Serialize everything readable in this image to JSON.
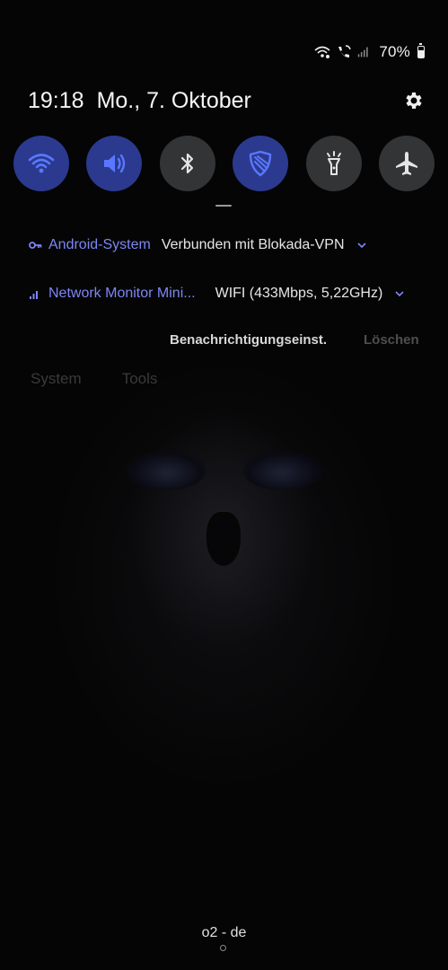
{
  "status_bar": {
    "battery_percent": "70%",
    "battery_level": 0.7,
    "icons": [
      "wifi-calling-icon",
      "vowifi-call-icon",
      "signal-bars-icon",
      "battery-icon"
    ]
  },
  "header": {
    "time": "19:18",
    "date": "Mo., 7. Oktober",
    "settings_icon": "gear-icon"
  },
  "quick_toggles": [
    {
      "name": "wifi",
      "icon": "wifi-icon",
      "active": true
    },
    {
      "name": "sound",
      "icon": "speaker-icon",
      "active": true
    },
    {
      "name": "bluetooth",
      "icon": "bluetooth-icon",
      "active": false
    },
    {
      "name": "blokada",
      "icon": "shield-icon",
      "active": true
    },
    {
      "name": "flashlight",
      "icon": "flashlight-icon",
      "active": false
    },
    {
      "name": "airplane-mode",
      "icon": "airplane-icon",
      "active": false
    }
  ],
  "notifications": [
    {
      "app": "Android-System",
      "icon": "vpn-key-icon",
      "text": "Verbunden mit Blokada-VPN"
    },
    {
      "app": "Network Monitor Mini...",
      "icon": "signal-bars-icon",
      "text": "WIFI  (433Mbps, 5,22GHz)"
    }
  ],
  "actions": {
    "notification_settings": "Benachrichtigungseinst.",
    "clear": "Löschen"
  },
  "tabs": [
    "System",
    "Tools"
  ],
  "carrier": "o2 - de",
  "colors": {
    "accent": "#7d86f5",
    "toggle_active": "#2b3a8f",
    "toggle_inactive": "#333436",
    "background": "#050505"
  }
}
